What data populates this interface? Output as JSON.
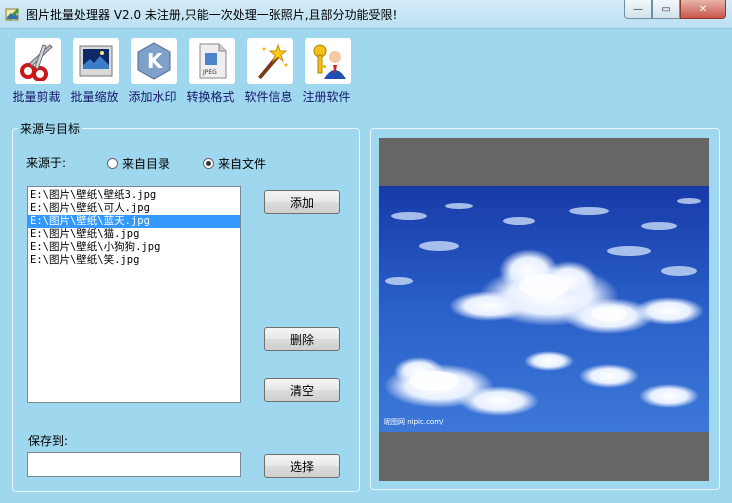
{
  "window": {
    "title": "图片批量处理器 V2.0  未注册,只能一次处理一张照片,且部分功能受限!",
    "controls": [
      "minimize-icon",
      "maximize-icon",
      "close-icon"
    ]
  },
  "toolbar": {
    "items": [
      {
        "label": "批量剪裁",
        "icon": "scissors-icon"
      },
      {
        "label": "批量缩放",
        "icon": "picture-icon"
      },
      {
        "label": "添加水印",
        "icon": "watermark-icon"
      },
      {
        "label": "转换格式",
        "icon": "jpeg-file-icon"
      },
      {
        "label": "软件信息",
        "icon": "magic-wand-icon"
      },
      {
        "label": "注册软件",
        "icon": "key-user-icon"
      }
    ]
  },
  "source_group": {
    "title": "来源与目标",
    "source_label": "来源于:",
    "options": [
      {
        "label": "来自目录",
        "selected": false
      },
      {
        "label": "来自文件",
        "selected": true
      }
    ],
    "files": [
      "E:\\图片\\壁纸\\壁纸3.jpg",
      "E:\\图片\\壁纸\\可人.jpg",
      "E:\\图片\\壁纸\\蓝天.jpg",
      "E:\\图片\\壁纸\\猫.jpg",
      "E:\\图片\\壁纸\\小狗狗.jpg",
      "E:\\图片\\壁纸\\笑.jpg"
    ],
    "selected_index": 2,
    "add_button": "添加",
    "delete_button": "删除",
    "clear_button": "清空",
    "save_label": "保存到:",
    "save_value": "",
    "choose_button": "选择"
  },
  "preview": {
    "watermark_text": "昵图网 nipic.com/",
    "colors": {
      "sky_top": "#1a3fb5",
      "sky_bottom": "#3c78d8",
      "frame_bg": "#666666",
      "window_bg": "#9fd8ee",
      "selection": "#3399ff"
    }
  }
}
